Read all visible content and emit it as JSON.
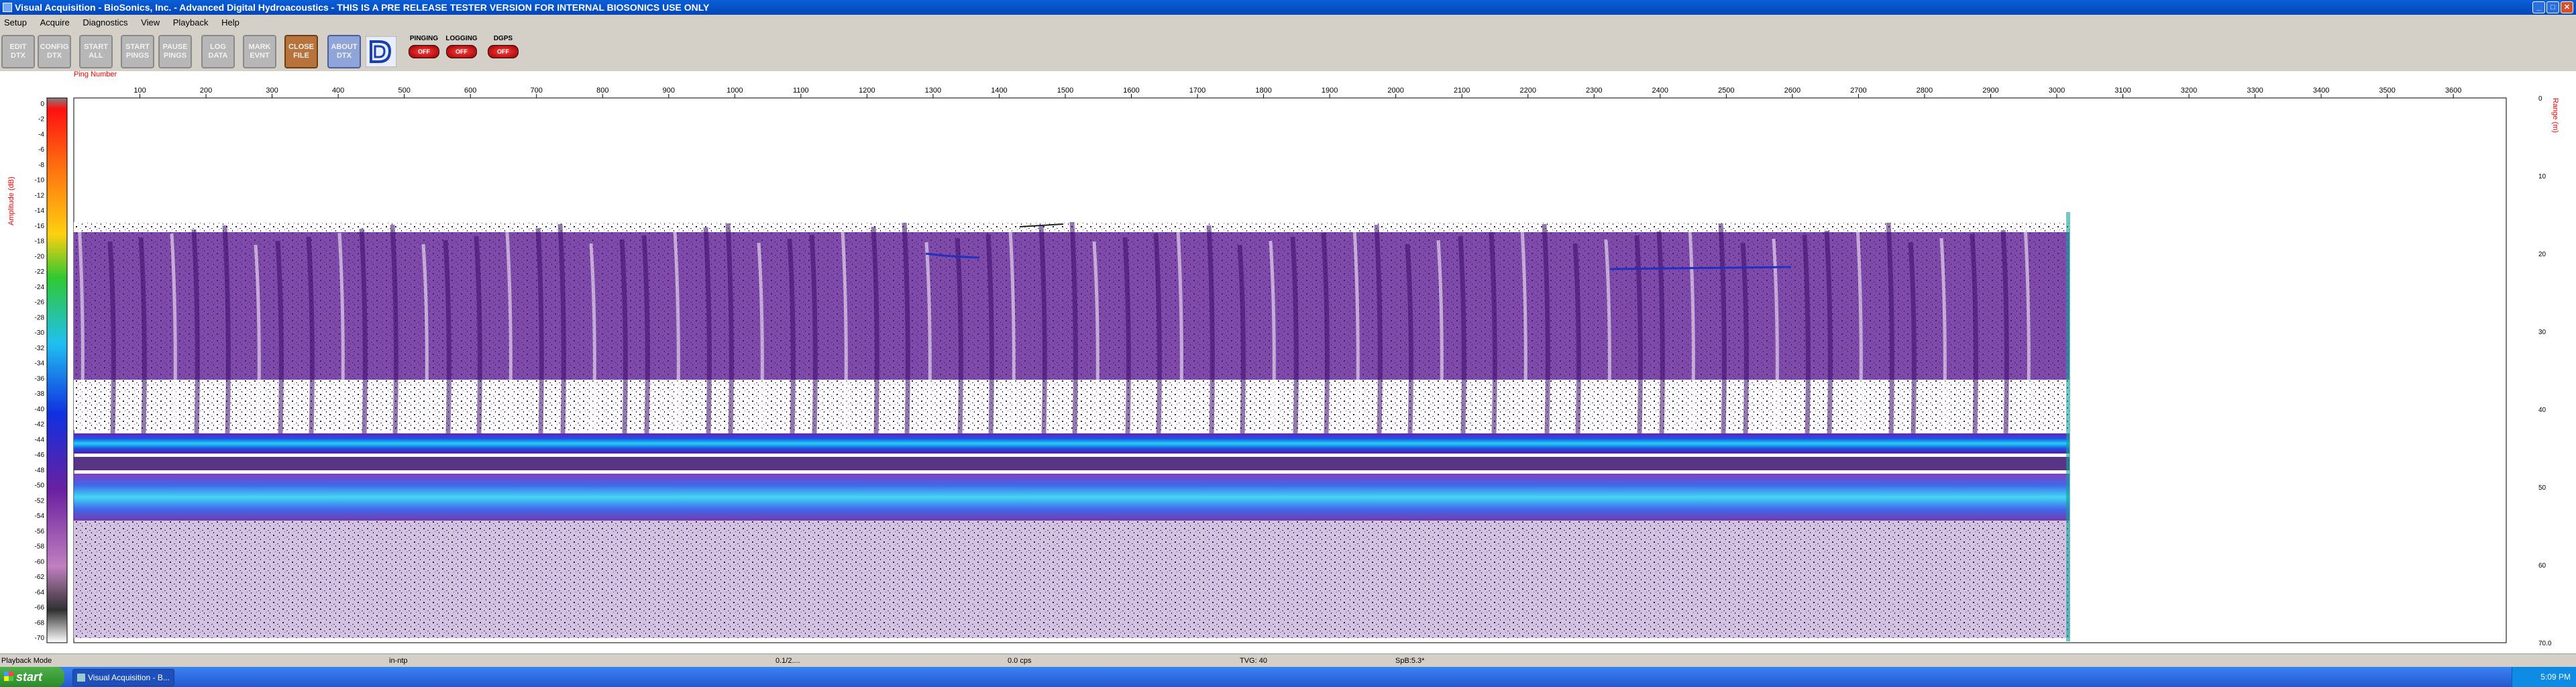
{
  "window": {
    "title": "Visual Acquisition  -  BioSonics, Inc.  -  Advanced Digital Hydroacoustics  -  THIS IS A PRE RELEASE TESTER VERSION FOR INTERNAL BIOSONICS USE ONLY",
    "minimize": "_",
    "maximize": "□",
    "close": "✕"
  },
  "menu": [
    "Setup",
    "Acquire",
    "Diagnostics",
    "View",
    "Playback",
    "Help"
  ],
  "toolbar": {
    "buttons": [
      {
        "label": "EDIT\nDTX"
      },
      {
        "label": "CONFIG\nDTX"
      },
      {
        "label": "START\nALL"
      },
      {
        "label": "START\nPINGS"
      },
      {
        "label": "PAUSE\nPINGS"
      },
      {
        "label": "LOG\nDATA"
      },
      {
        "label": "MARK\nEVNT"
      },
      {
        "label": "CLOSE\nFILE"
      },
      {
        "label": "ABOUT\nDTX"
      }
    ],
    "logo": "biosonics-logo-icon",
    "indicators": [
      {
        "label": "PINGING",
        "lamp": "OFF"
      },
      {
        "label": "LOGGING",
        "lamp": "OFF"
      },
      {
        "label": "DGPS",
        "lamp": "OFF"
      }
    ]
  },
  "echogram": {
    "x_axis_label": "Ping Number",
    "left_axis_label": "Amplitude (dB)",
    "right_axis_label": "Range (m)",
    "x_ticks": [
      100,
      200,
      300,
      400,
      500,
      600,
      700,
      800,
      900,
      1000,
      1100,
      1200,
      1300,
      1400,
      1500,
      1600,
      1700,
      1800,
      1900,
      2000,
      2100,
      2200,
      2300,
      2400,
      2500,
      2600,
      2700,
      2800,
      2900,
      3000,
      3100,
      3200,
      3300,
      3400,
      3500,
      3600
    ],
    "amp_ticks": [
      0,
      -2,
      -4,
      -6,
      -8,
      -10,
      -12,
      -14,
      -16,
      -18,
      -20,
      -22,
      -24,
      -26,
      -28,
      -30,
      -32,
      -34,
      -36,
      -38,
      -40,
      -42,
      -44,
      -46,
      -48,
      -50,
      -52,
      -54,
      -56,
      -58,
      -60,
      -62,
      -64,
      -66,
      -68,
      -70
    ],
    "range_ticks": [
      "0",
      "10",
      "20",
      "30",
      "40",
      "50",
      "60",
      "70.0"
    ],
    "colors": {
      "accent": "#ff0000",
      "bottom_band": "#18c8e8",
      "water_column": "#5a1890"
    }
  },
  "status": {
    "mode": "Playback Mode",
    "units": "in-ntp",
    "ping": "0.1/2....",
    "rate": "0.0 cps",
    "tvg": "TVG: 40",
    "spb": "SpB:5.3*"
  },
  "taskbar": {
    "start": "start",
    "task": "Visual Acquisition  -  B...",
    "clock": "5:09 PM"
  }
}
